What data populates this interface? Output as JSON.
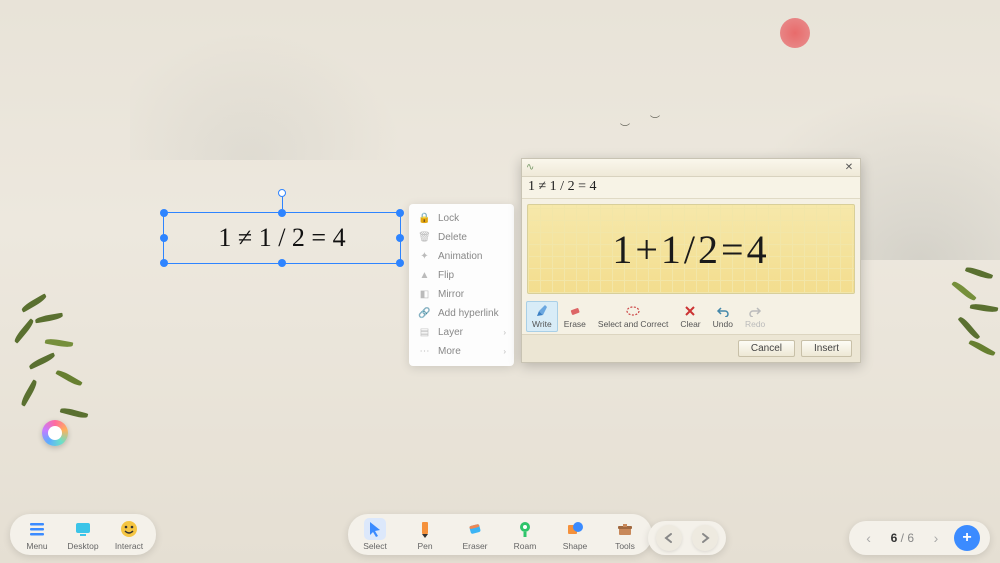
{
  "canvas": {
    "formula_display": "1 ≠ 1 / 2 = 4"
  },
  "context_menu": {
    "items": [
      {
        "label": "Lock",
        "icon": "lock"
      },
      {
        "label": "Delete",
        "icon": "trash"
      },
      {
        "label": "Animation",
        "icon": "sparkle"
      },
      {
        "label": "Flip",
        "icon": "flip"
      },
      {
        "label": "Mirror",
        "icon": "mirror"
      },
      {
        "label": "Add hyperlink",
        "icon": "link"
      },
      {
        "label": "Layer",
        "icon": "layers",
        "submenu": true
      },
      {
        "label": "More",
        "icon": "dots",
        "submenu": true
      }
    ]
  },
  "math_panel": {
    "preview_text": "1 ≠ 1 / 2 = 4",
    "handwriting_text": "1+1/2=4",
    "tools": [
      {
        "label": "Write",
        "selected": true
      },
      {
        "label": "Erase"
      },
      {
        "label": "Select and Correct"
      },
      {
        "label": "Clear"
      },
      {
        "label": "Undo"
      },
      {
        "label": "Redo",
        "disabled": true
      }
    ],
    "cancel_label": "Cancel",
    "insert_label": "Insert"
  },
  "toolbar_left": [
    {
      "label": "Menu",
      "icon": "menu"
    },
    {
      "label": "Desktop",
      "icon": "desktop"
    },
    {
      "label": "Interact",
      "icon": "interact"
    }
  ],
  "toolbar_center": [
    {
      "label": "Select",
      "icon": "cursor",
      "selected": true
    },
    {
      "label": "Pen",
      "icon": "pen"
    },
    {
      "label": "Eraser",
      "icon": "eraser"
    },
    {
      "label": "Roam",
      "icon": "roam"
    },
    {
      "label": "Shape",
      "icon": "shape"
    },
    {
      "label": "Tools",
      "icon": "tools"
    }
  ],
  "pagination": {
    "current": "6",
    "total": "6",
    "sep": " / "
  }
}
